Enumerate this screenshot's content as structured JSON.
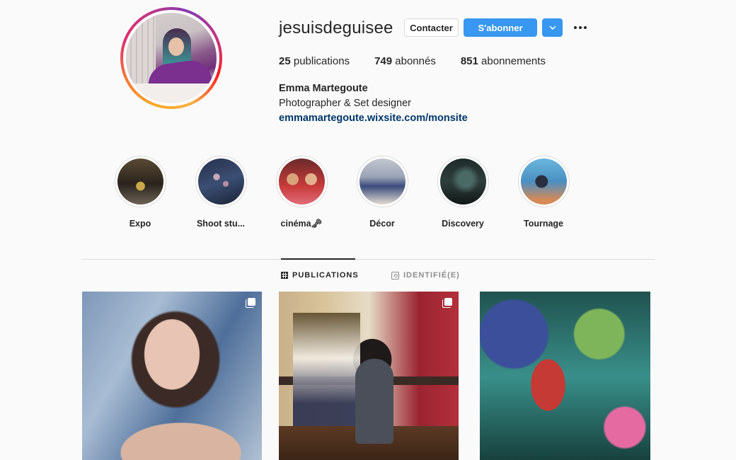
{
  "profile": {
    "username": "jesuisdeguisee",
    "full_name": "Emma Martegoute",
    "bio": "Photographer & Set designer",
    "website": "emmamartegoute.wixsite.com/monsite"
  },
  "actions": {
    "contact_label": "Contacter",
    "follow_label": "S'abonner",
    "dropdown_icon": "chevron-down-icon",
    "more_icon": "more-options-icon"
  },
  "stats": {
    "posts_count": "25",
    "posts_label": " publications",
    "followers_count": "749",
    "followers_label": " abonnés",
    "following_count": "851",
    "following_label": " abonnements"
  },
  "highlights": [
    {
      "label": "Expo"
    },
    {
      "label": "Shoot stu..."
    },
    {
      "label": "cinéma🗝"
    },
    {
      "label": "Décor"
    },
    {
      "label": "Discovery"
    },
    {
      "label": "Tournage"
    }
  ],
  "tabs": {
    "publications": "PUBLICATIONS",
    "tagged": "IDENTIFIÉ(E)"
  },
  "colors": {
    "accent": "#3897f0",
    "link": "#00376b",
    "text": "#262626",
    "muted": "#8e8e8e",
    "border": "#dbdbdb"
  }
}
